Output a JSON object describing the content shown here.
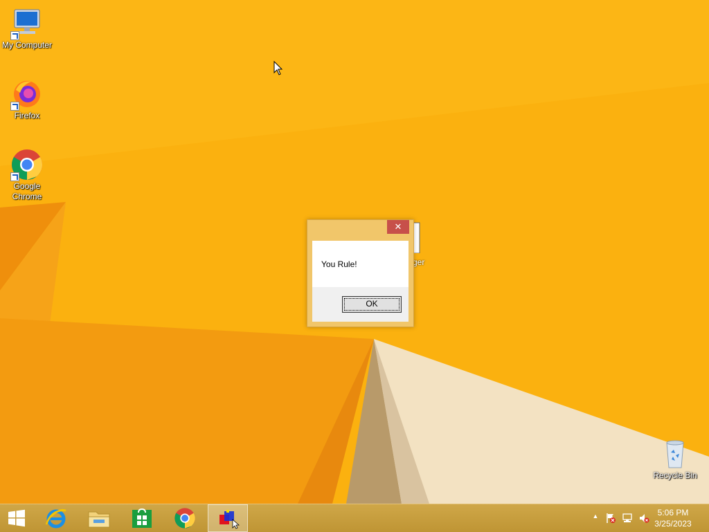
{
  "desktop": {
    "icons": [
      {
        "label": "My Computer",
        "icon": "computer-icon"
      },
      {
        "label": "Firefox",
        "icon": "firefox-icon"
      },
      {
        "label": "Google Chrome",
        "icon": "chrome-icon"
      },
      {
        "label": "Recycle Bin",
        "icon": "recycle-bin-icon"
      }
    ],
    "partial_icon_label": "rger"
  },
  "dialog": {
    "message": "You Rule!",
    "ok_label": "OK",
    "close_glyph": "✕"
  },
  "taskbar": {
    "pinned": [
      {
        "name": "internet-explorer",
        "icon": "ie-icon"
      },
      {
        "name": "file-explorer",
        "icon": "folder-icon"
      },
      {
        "name": "store",
        "icon": "store-icon"
      },
      {
        "name": "chrome",
        "icon": "chrome-icon"
      },
      {
        "name": "running-app",
        "icon": "app-blocks-icon",
        "active": true
      }
    ],
    "tray": {
      "overflow_glyph": "▲",
      "icons": [
        "action-center-flag-icon",
        "network-icon",
        "volume-muted-icon"
      ]
    },
    "clock": {
      "time": "5:06 PM",
      "date": "3/25/2023"
    }
  },
  "colors": {
    "wallpaper": "#f9a80b",
    "taskbar": "#c79c3d",
    "dialog_frame": "#f1c66a",
    "close_button": "#c7504a"
  }
}
